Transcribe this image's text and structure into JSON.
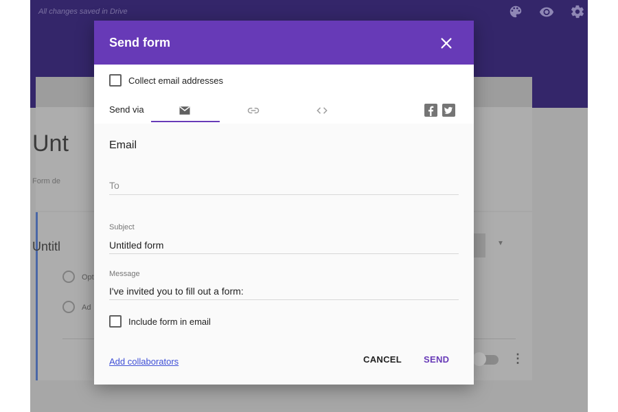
{
  "app": {
    "save_status": "All changes saved in Drive",
    "header_icons": [
      "palette-icon",
      "eye-icon",
      "gear-icon"
    ],
    "form_title": "Unt",
    "form_description": "Form de",
    "question_title": "Untitl",
    "options": [
      "Opt",
      "Ad"
    ],
    "colors": {
      "header_bg": "#34266a",
      "overlay": "#a7a7a7"
    }
  },
  "dialog": {
    "title": "Send form",
    "close_icon": "close-icon",
    "collect_email_label": "Collect email addresses",
    "send_via_label": "Send via",
    "tabs": [
      {
        "name": "email",
        "icon": "envelope-icon",
        "selected": true
      },
      {
        "name": "link",
        "icon": "link-icon",
        "selected": false
      },
      {
        "name": "embed",
        "icon": "embed-code-icon",
        "selected": false
      }
    ],
    "social": [
      "facebook-icon",
      "twitter-icon"
    ],
    "section_heading": "Email",
    "to": {
      "placeholder": "To",
      "value": ""
    },
    "subject": {
      "label": "Subject",
      "value": "Untitled form"
    },
    "message": {
      "label": "Message",
      "value": "I've invited you to fill out a form:"
    },
    "include_form_label": "Include form in email",
    "add_collaborators": "Add collaborators",
    "cancel": "CANCEL",
    "send": "SEND",
    "colors": {
      "accent": "#673ab7",
      "link": "#3e4fd6"
    }
  }
}
